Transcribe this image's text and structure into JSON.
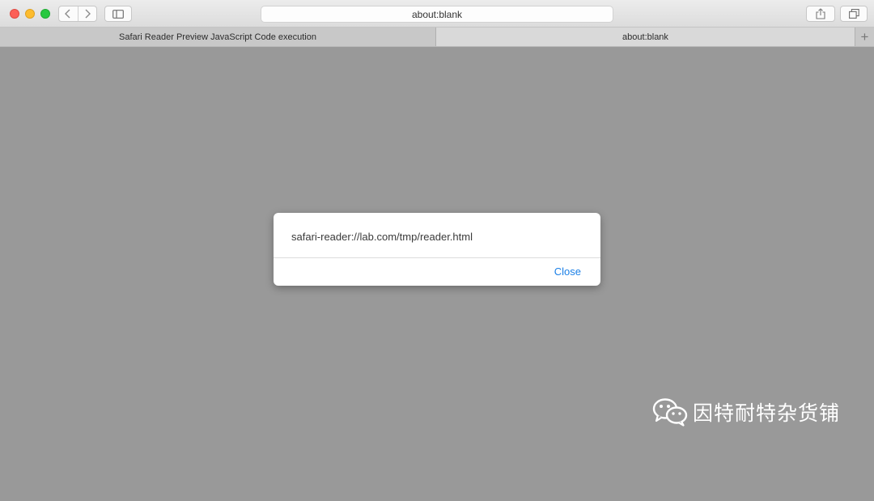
{
  "toolbar": {
    "address": "about:blank",
    "icons": {
      "back": "chevron-left-icon",
      "forward": "chevron-right-icon",
      "sidebar": "sidebar-icon",
      "share": "share-icon",
      "tabs": "tabs-overview-icon"
    }
  },
  "tabs": [
    {
      "title": "Safari Reader Preview JavaScript Code execution",
      "active": false
    },
    {
      "title": "about:blank",
      "active": true
    }
  ],
  "tab_add_label": "+",
  "dialog": {
    "message": "safari-reader://lab.com/tmp/reader.html",
    "close_label": "Close"
  },
  "watermark": {
    "text": "因特耐特杂货铺",
    "icon": "wechat-icon"
  },
  "colors": {
    "content_bg": "#999999",
    "accent": "#1a7fe6",
    "traffic_red": "#fc5f57",
    "traffic_yellow": "#fdbc2e",
    "traffic_green": "#28c840"
  }
}
